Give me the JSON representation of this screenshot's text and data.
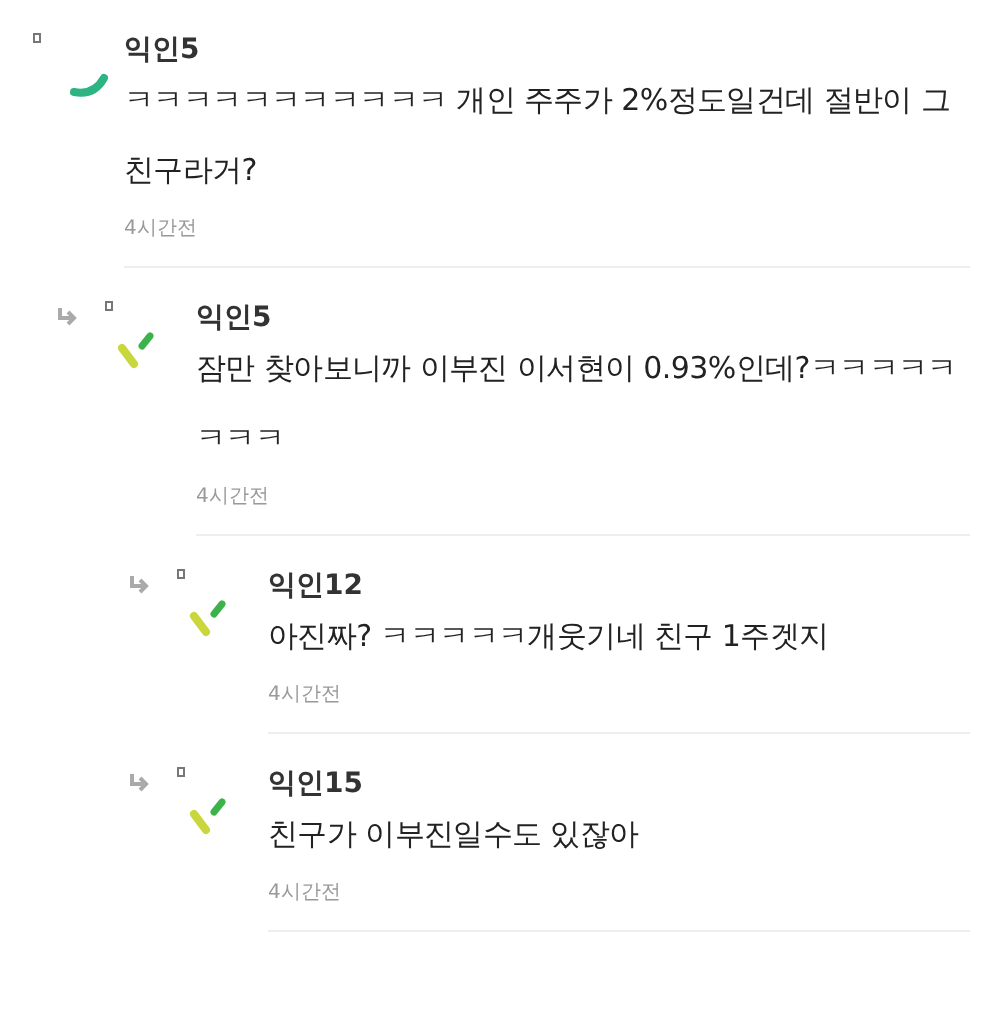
{
  "comments": [
    {
      "author": "익인5",
      "kind": "arc",
      "text": "ㅋㅋㅋㅋㅋㅋㅋㅋㅋㅋㅋ 개인 주주가 2%정도일건데 절반이 그 친구라거?",
      "time": "4시간전",
      "children": [
        {
          "author": "익인5",
          "kind": "strokes",
          "text": "잠만 찾아보니까 이부진 이서현이 0.93%인데?ㅋㅋㅋㅋㅋㅋㅋㅋ",
          "time": "4시간전",
          "children": [
            {
              "author": "익인12",
              "kind": "strokes",
              "text": "아진짜? ㅋㅋㅋㅋㅋ개웃기네 친구 1주겟지",
              "time": "4시간전"
            },
            {
              "author": "익인15",
              "kind": "strokes",
              "text": "친구가 이부진일수도 있잖아",
              "time": "4시간전"
            }
          ]
        }
      ]
    }
  ]
}
